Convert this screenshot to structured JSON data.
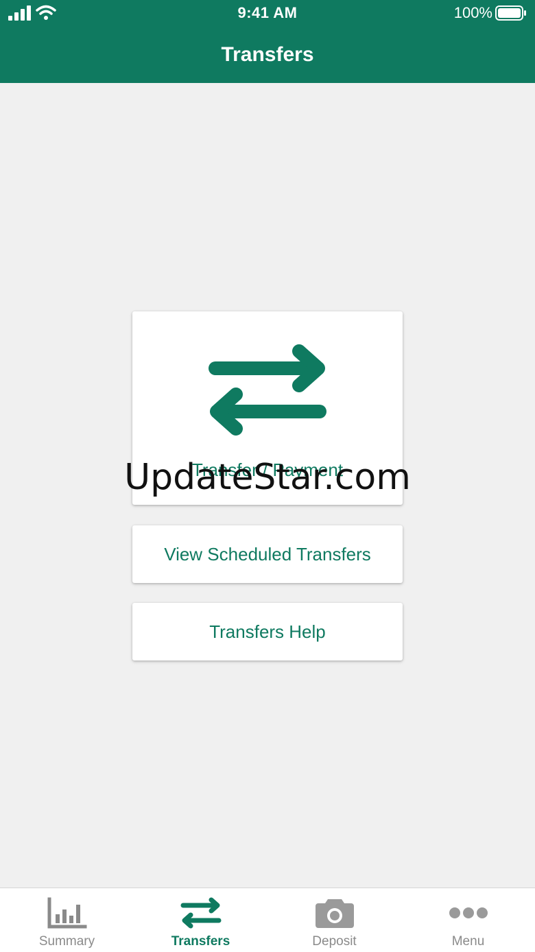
{
  "status_bar": {
    "time": "9:41 AM",
    "battery": "100%",
    "signal_icon": "cellular-signal-icon",
    "wifi_icon": "wifi-icon",
    "battery_icon": "battery-icon"
  },
  "header": {
    "title": "Transfers"
  },
  "cards": {
    "main": {
      "label": "Transfer / Payment",
      "icon": "transfer-arrows-icon"
    },
    "scheduled": {
      "label": "View Scheduled Transfers"
    },
    "help": {
      "label": "Transfers Help"
    }
  },
  "watermark": "UpdateStar.com",
  "tabbar": {
    "active": "Transfers",
    "items": [
      {
        "label": "Summary",
        "icon": "bar-chart-icon"
      },
      {
        "label": "Transfers",
        "icon": "transfer-arrows-icon"
      },
      {
        "label": "Deposit",
        "icon": "camera-icon"
      },
      {
        "label": "Menu",
        "icon": "more-dots-icon"
      }
    ]
  },
  "colors": {
    "brand": "#0f7a60",
    "background": "#f0f0f0",
    "inactive": "#8a8a8a",
    "card": "#ffffff"
  }
}
